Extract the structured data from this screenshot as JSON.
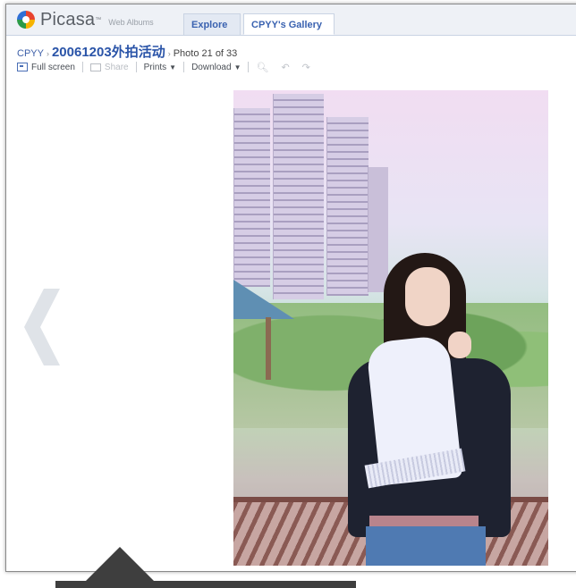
{
  "app": {
    "logo_text": "Picasa",
    "logo_tm": "™",
    "logo_subtitle": "Web Albums"
  },
  "tabs": [
    {
      "label": "Explore",
      "active": false
    },
    {
      "label": "CPYY's Gallery",
      "active": true
    }
  ],
  "breadcrumb": {
    "user": "CPYY",
    "album": "20061203外拍活动",
    "position": "Photo 21 of 33"
  },
  "toolbar": {
    "full_screen": "Full screen",
    "share": "Share",
    "prints": "Prints",
    "download": "Download"
  },
  "icons": {
    "logo": "picasa-pinwheel-icon",
    "full_screen": "fullscreen-icon",
    "share": "envelope-icon",
    "zoom": "magnifier-icon",
    "rotate_left": "rotate-left-icon",
    "rotate_right": "rotate-right-icon",
    "prev": "chevron-left-icon"
  },
  "colors": {
    "link_blue": "#2a54a8",
    "tab_bar": "#eef1f6",
    "disabled": "#b8bcc2"
  }
}
